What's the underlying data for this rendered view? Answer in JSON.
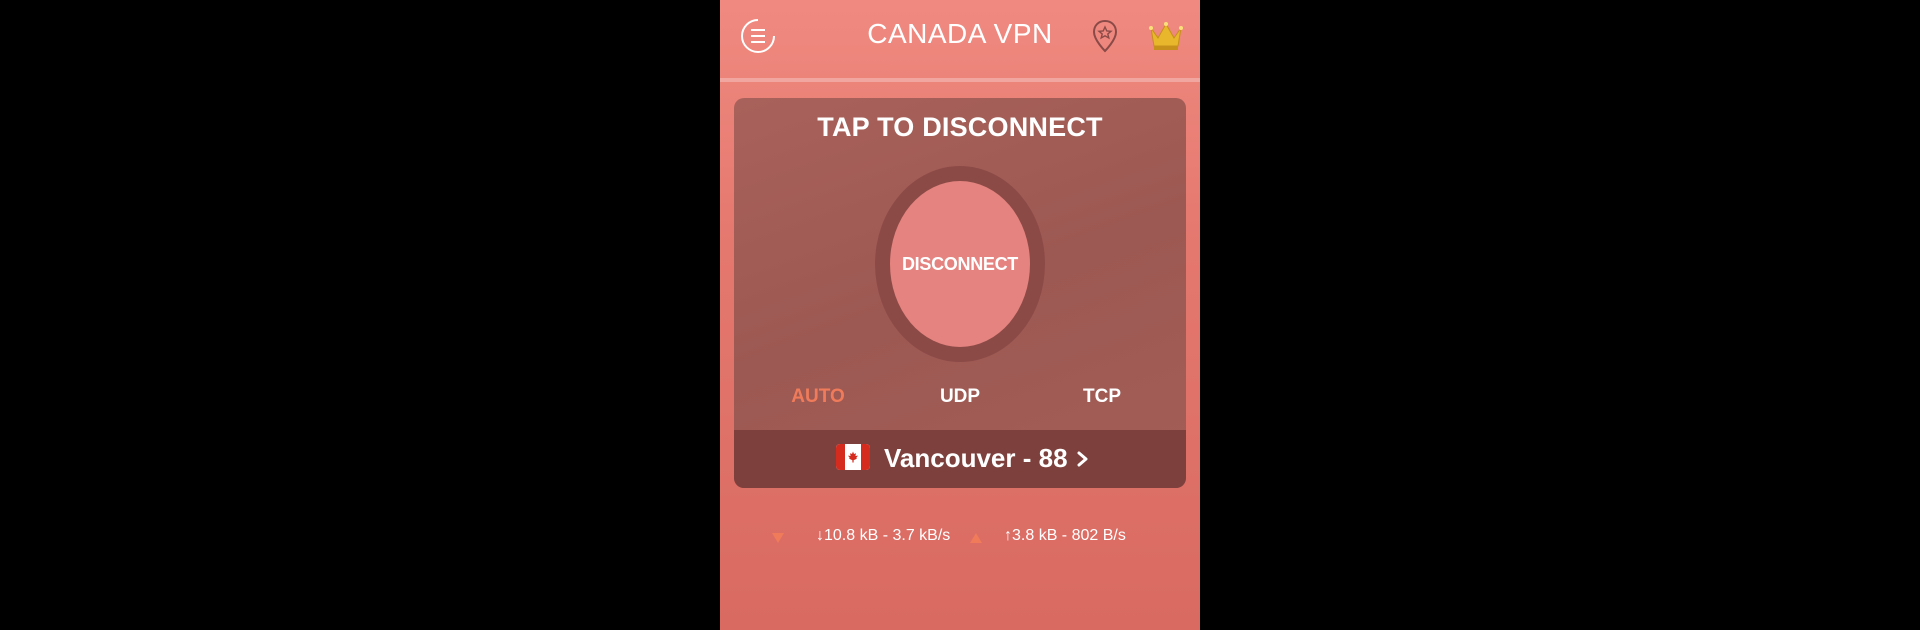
{
  "header": {
    "title": "CANADA VPN",
    "menu_icon": "hamburger-circle-icon",
    "location_icon": "location-pin-icon",
    "premium_icon": "crown-icon"
  },
  "connection": {
    "heading": "TAP TO DISCONNECT",
    "button_label": "DISCONNECT"
  },
  "protocols": {
    "items": [
      "AUTO",
      "UDP",
      "TCP"
    ],
    "selected": "AUTO"
  },
  "server": {
    "flag_icon": "canada-flag-icon",
    "name": "Vancouver - 88"
  },
  "traffic": {
    "download": "↓10.8 kB - 3.7 kB/s",
    "upload": "↑3.8 kB - 802 B/s"
  },
  "colors": {
    "background_top": "#f08a80",
    "card": "#9c5852",
    "accent_selected": "#f07b5a",
    "crown": "#e9b72c",
    "flag_red": "#d52b1e"
  }
}
